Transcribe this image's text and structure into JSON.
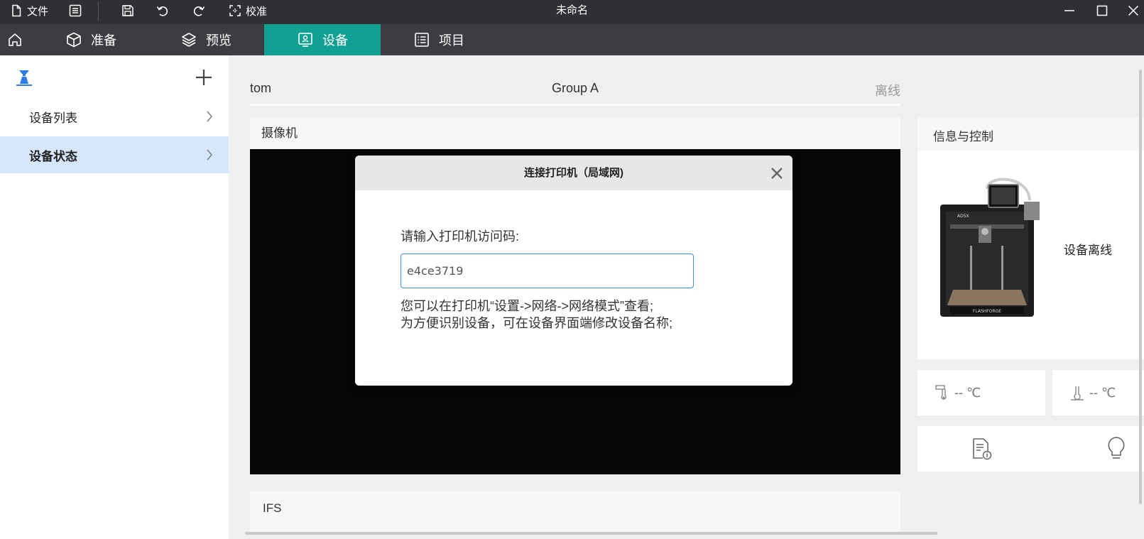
{
  "titlebar": {
    "file_label": "文件",
    "calibrate_label": "校准",
    "window_title": "未命名"
  },
  "tabs": [
    {
      "label": "准备"
    },
    {
      "label": "预览"
    },
    {
      "label": "设备",
      "active": true
    },
    {
      "label": "项目"
    }
  ],
  "sidebar": {
    "items": [
      {
        "label": "设备列表"
      },
      {
        "label": "设备状态",
        "active": true
      }
    ]
  },
  "device": {
    "name": "tom",
    "group": "Group A",
    "status": "离线"
  },
  "camera": {
    "title": "摄像机"
  },
  "ifs": {
    "title": "IFS"
  },
  "info": {
    "title": "信息与控制",
    "offline_text": "设备离线",
    "nozzle_temp": "-- ℃",
    "bed_temp": "-- ℃"
  },
  "dialog": {
    "title": "连接打印机（局域网)",
    "prompt": "请输入打印机访问码:",
    "input_value": "e4ce3719",
    "hint_line1": "您可以在打印机“设置->网络->网络模式”查看;",
    "hint_line2": "为方便识别设备，可在设备界面端修改设备名称;"
  },
  "colors": {
    "accent": "#10a192",
    "titlebar_bg": "#2f3033",
    "tabbar_bg": "#3c3d40",
    "sidebar_active_bg": "#d6e6fb",
    "input_border": "#3a8ee6"
  }
}
